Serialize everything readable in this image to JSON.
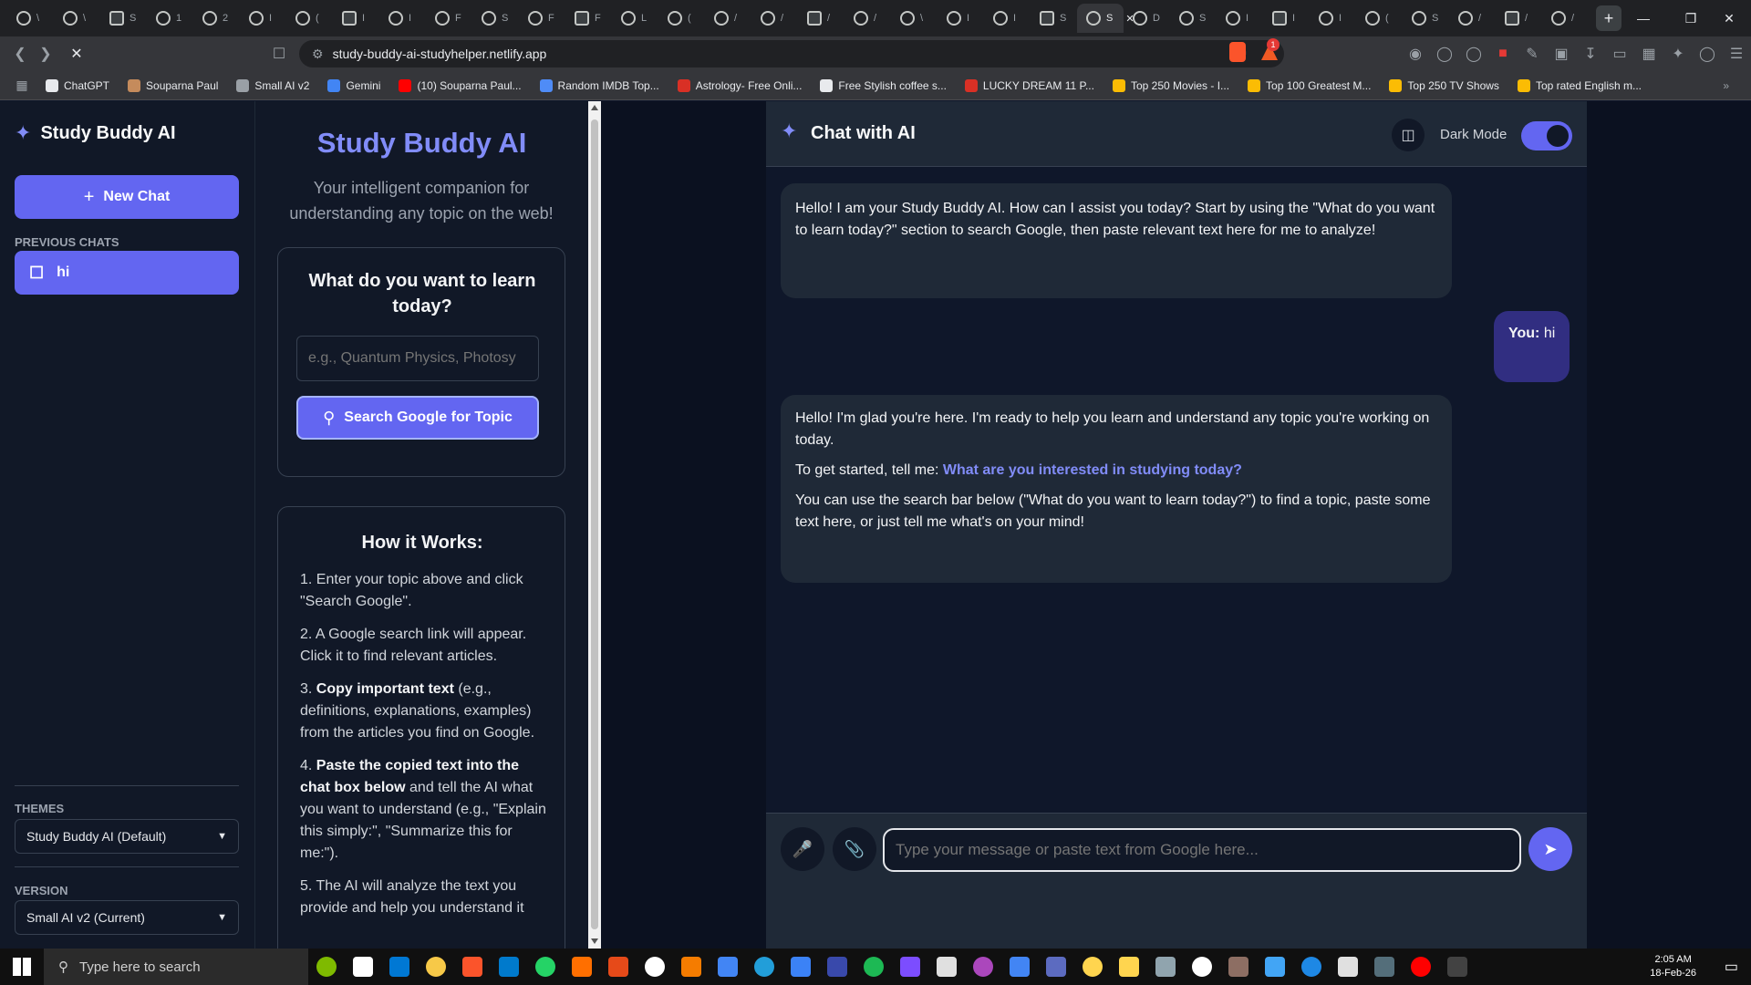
{
  "browser": {
    "url": "study-buddy-ai-studyhelper.netlify.app",
    "tabs": [
      "\\",
      "\\",
      "S",
      "1",
      "2",
      "I",
      "(",
      "I",
      "I",
      "F",
      "S",
      "F",
      "F",
      "L",
      "(",
      "/",
      "/",
      "/",
      "/",
      "\\",
      "I",
      "I",
      "S",
      "",
      "D",
      "S",
      "I",
      "I",
      "I",
      "(",
      "S",
      "/",
      "/",
      "/"
    ],
    "active_tab_label": "S",
    "bookmarks": [
      "ChatGPT",
      "Souparna Paul",
      "Small AI v2",
      "Gemini",
      "(10) Souparna Paul...",
      "Random IMDB Top...",
      "Astrology- Free Onli...",
      "Free Stylish coffee s...",
      "LUCKY DREAM 11 P...",
      "Top 250 Movies - I...",
      "Top 100 Greatest M...",
      "Top 250 TV Shows",
      "Top rated English m..."
    ],
    "alert_count": "1"
  },
  "sidebar": {
    "app_title": "Study Buddy AI",
    "new_chat_label": "New Chat",
    "previous_chats_heading": "PREVIOUS CHATS",
    "chats": [
      "hi"
    ],
    "themes_heading": "THEMES",
    "theme_selected": "Study Buddy AI (Default)",
    "version_heading": "VERSION",
    "version_selected": "Small AI v2 (Current)"
  },
  "helper": {
    "title": "Study Buddy AI",
    "tagline": "Your intelligent companion for understanding any topic on the web!",
    "learn_heading": "What do you want to learn today?",
    "topic_placeholder": "e.g., Quantum Physics, Photosy",
    "search_button_label": "Search Google for Topic",
    "how_heading": "How it Works:",
    "steps": [
      {
        "prefix": "1. ",
        "bold": "",
        "text": "Enter your topic above and click \"Search Google\"."
      },
      {
        "prefix": "2. ",
        "bold": "",
        "text": "A Google search link will appear. Click it to find relevant articles."
      },
      {
        "prefix": "3. ",
        "bold": "Copy important text",
        "text": " (e.g., definitions, explanations, examples) from the articles you find on Google."
      },
      {
        "prefix": "4. ",
        "bold": "Paste the copied text into the chat box below",
        "text": " and tell the AI what you want to understand (e.g., \"Explain this simply:\", \"Summarize this for me:\")."
      },
      {
        "prefix": "5. ",
        "bold": "",
        "text": "The AI will analyze the text you provide and help you understand it"
      }
    ]
  },
  "chat": {
    "title": "Chat with AI",
    "dark_mode_label": "Dark Mode",
    "dark_mode_on": true,
    "messages": [
      {
        "role": "ai",
        "text": "Hello! I am your Study Buddy AI. How can I assist you today? Start by using the \"What do you want to learn today?\" section to search Google, then paste relevant text here for me to analyze!"
      },
      {
        "role": "user",
        "label": "You:",
        "text": "hi"
      },
      {
        "role": "ai",
        "p1": "Hello! I'm glad you're here. I'm ready to help you learn and understand any topic you're working on today.",
        "p2_prefix": "To get started, tell me:",
        "p2_link": "What are you interested in studying today?",
        "p3": "You can use the search bar below (\"What do you want to learn today?\") to find a topic, paste some text here, or just tell me what's on your mind!"
      }
    ],
    "input_placeholder": "Type your message or paste text from Google here..."
  },
  "taskbar": {
    "search_placeholder": "Type here to search",
    "time": "2:05 AM",
    "date": "18-Feb-26"
  },
  "colors": {
    "accent": "#6366f1",
    "accent_text": "#818cf8",
    "user_bubble": "#312e81",
    "ai_bubble": "#1f2937"
  }
}
